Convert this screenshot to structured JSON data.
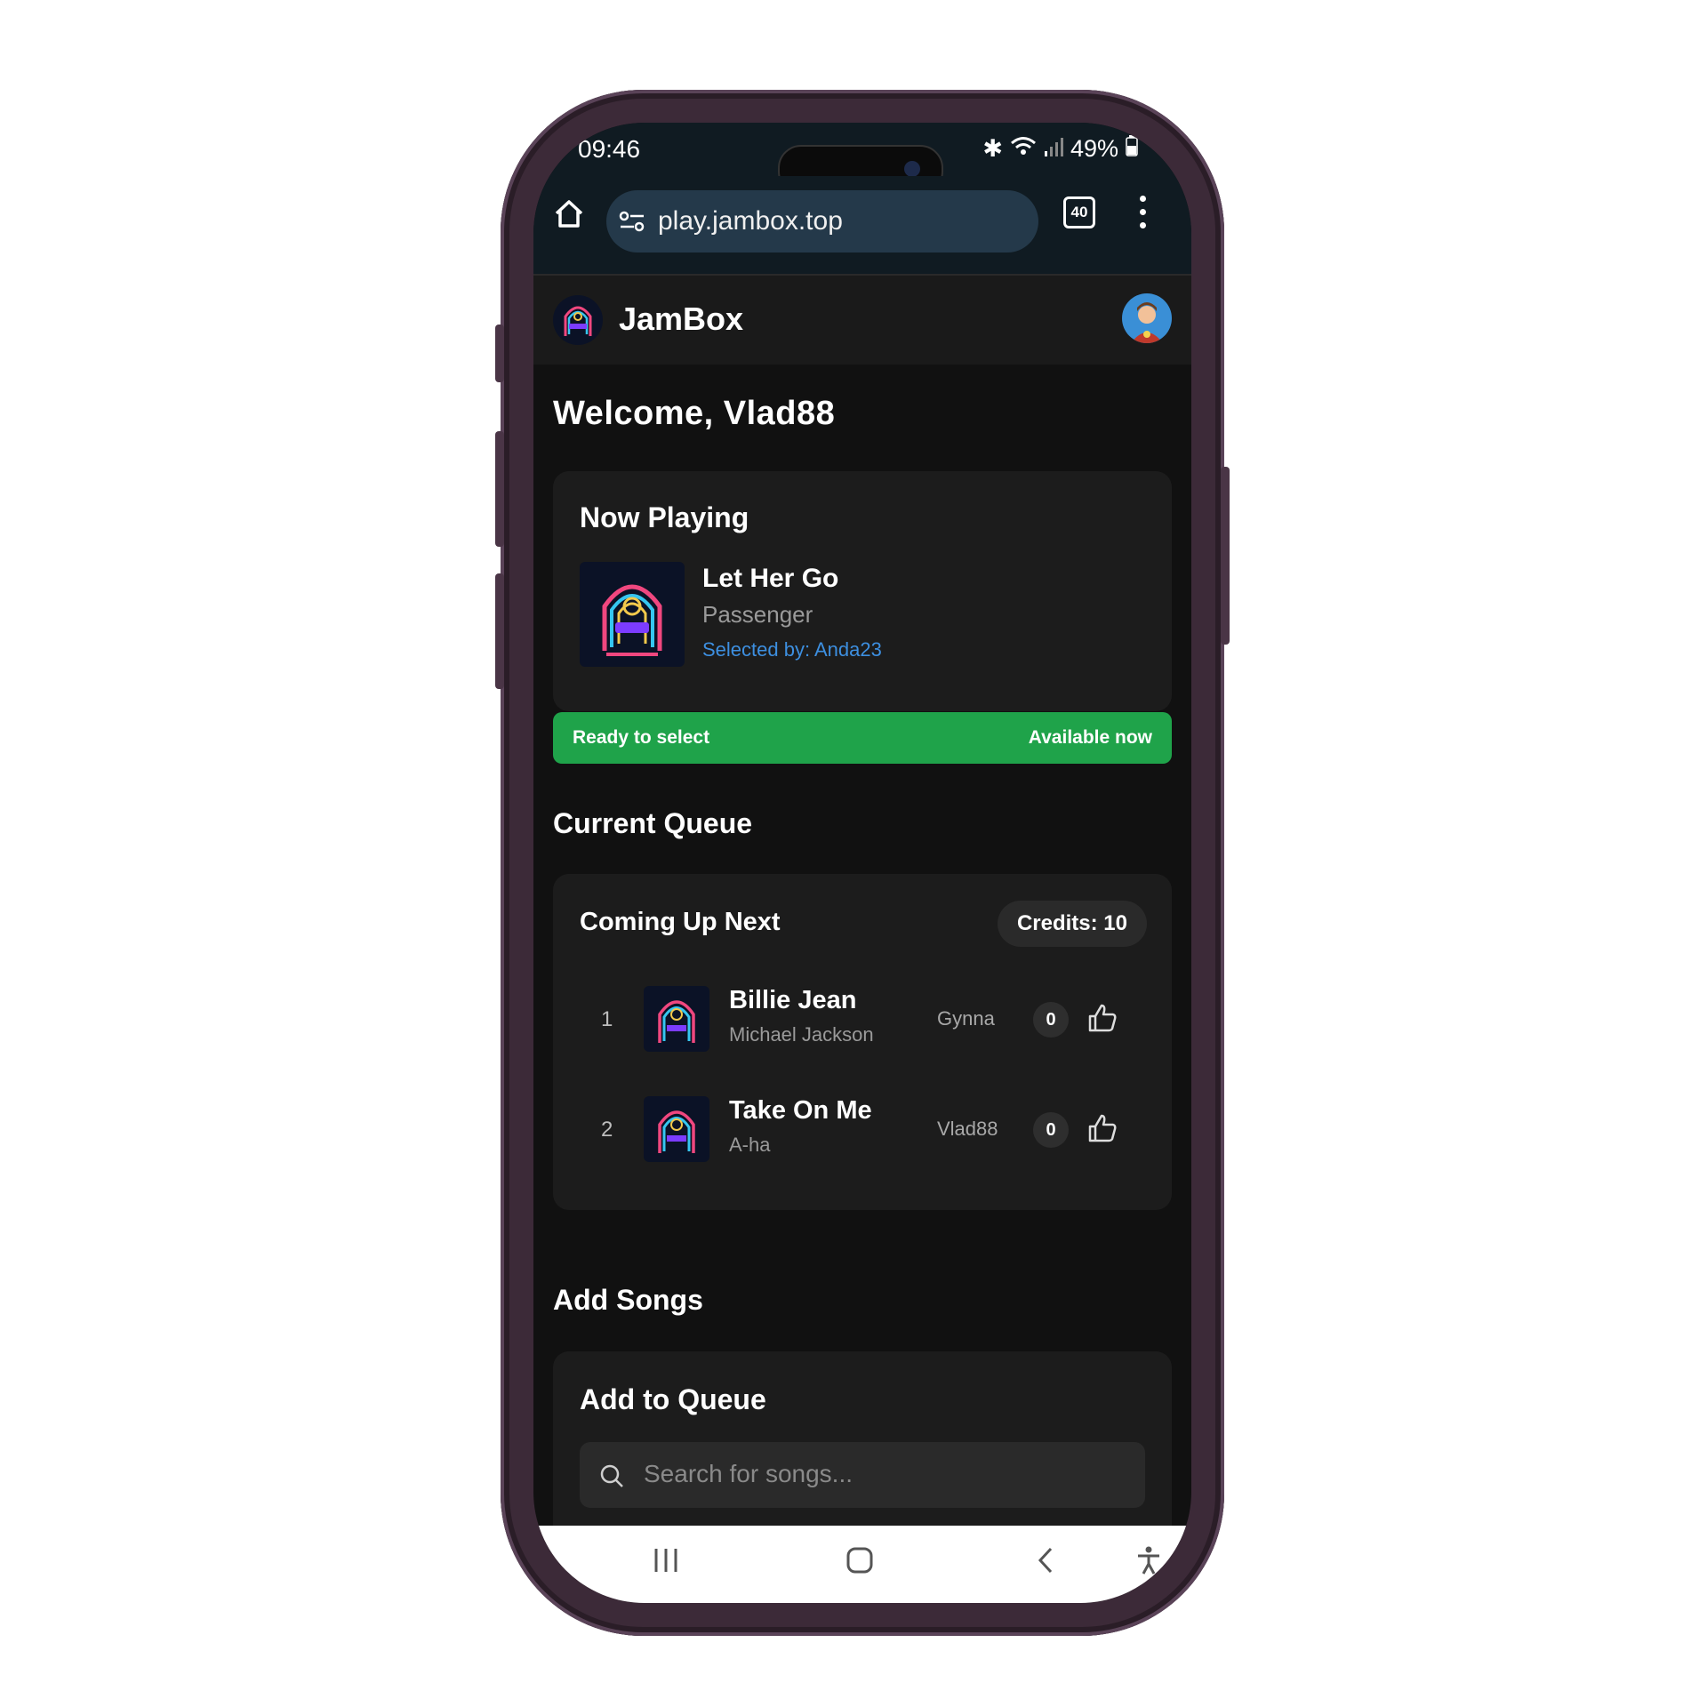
{
  "status_bar": {
    "time": "09:46",
    "battery": "49%"
  },
  "browser": {
    "url": "play.jambox.top",
    "tab_count": "40"
  },
  "app": {
    "title": "JamBox"
  },
  "welcome": "Welcome, Vlad88",
  "now_playing": {
    "heading": "Now Playing",
    "song": "Let Her Go",
    "artist": "Passenger",
    "selected_by": "Selected by: Anda23"
  },
  "ready_bar": {
    "left": "Ready to select",
    "right": "Available now",
    "color": "#1fa34a"
  },
  "queue": {
    "section_title": "Current Queue",
    "card_title": "Coming Up Next",
    "credits": "Credits: 10",
    "items": [
      {
        "position": "1",
        "song": "Billie Jean",
        "artist": "Michael Jackson",
        "user": "Gynna",
        "votes": "0"
      },
      {
        "position": "2",
        "song": "Take On Me",
        "artist": "A-ha",
        "user": "Vlad88",
        "votes": "0"
      }
    ]
  },
  "add_songs": {
    "section_title": "Add Songs",
    "card_title": "Add to Queue",
    "search_placeholder": "Search for songs..."
  },
  "icons": [
    "home-icon",
    "settings-icon",
    "tabs-icon",
    "more-icon",
    "thumbs-up-icon",
    "search-icon",
    "recents-icon",
    "home-nav-icon",
    "back-icon",
    "accessibility-icon"
  ]
}
